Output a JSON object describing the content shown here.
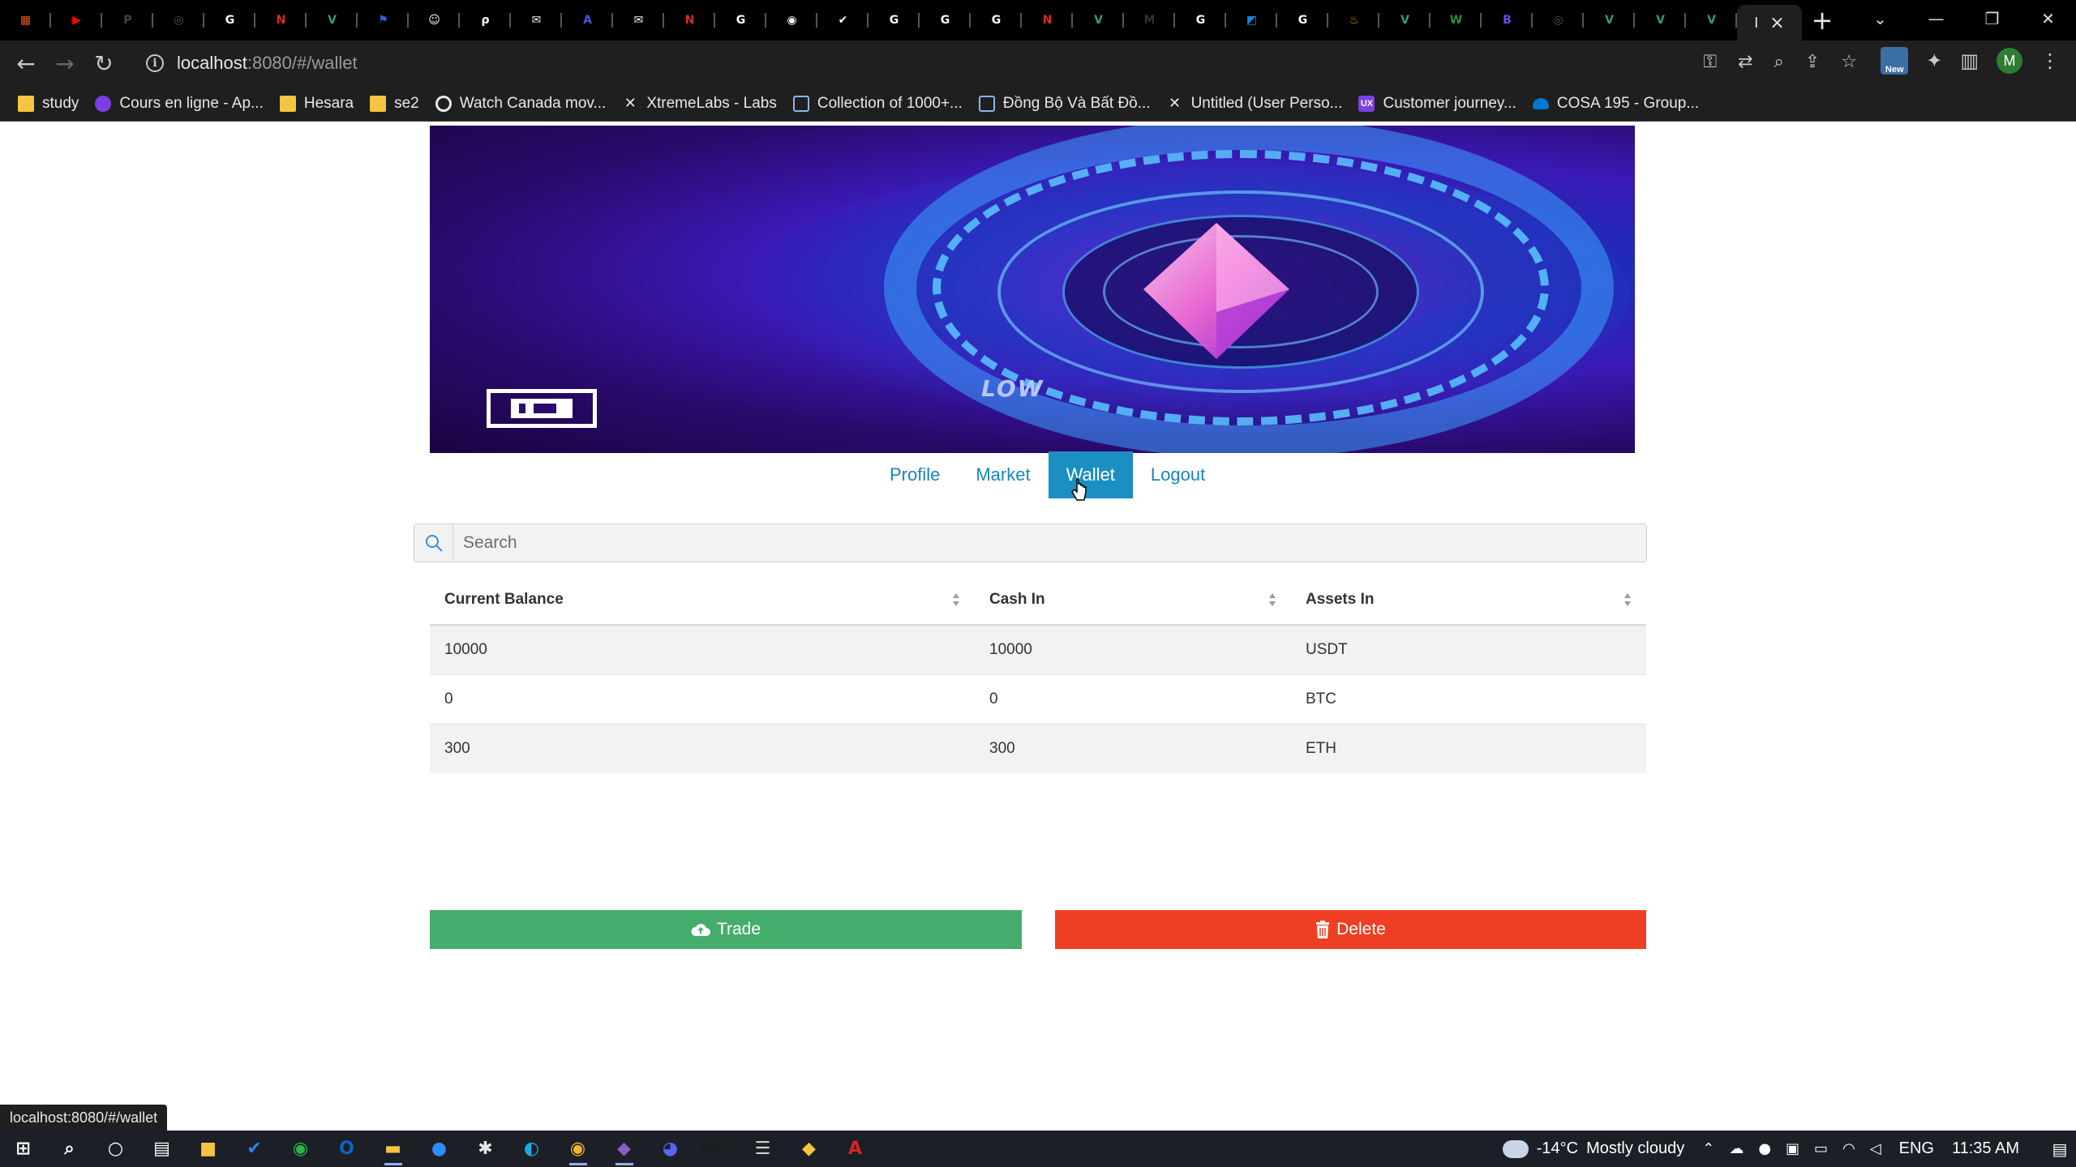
{
  "browser": {
    "tabs": [
      {
        "icon": "grid-app-icon",
        "color": "#e8590c",
        "glyph": "▦"
      },
      {
        "icon": "youtube-icon",
        "color": "#ff0000",
        "glyph": "▶"
      },
      {
        "icon": "pdf-tab-icon",
        "color": "#444444",
        "glyph": "P"
      },
      {
        "icon": "globe-icon",
        "color": "#555555",
        "glyph": "◎"
      },
      {
        "icon": "google-icon",
        "color": "#ffffff",
        "glyph": "G"
      },
      {
        "icon": "notion-red-icon",
        "color": "#d92b2b",
        "glyph": "N"
      },
      {
        "icon": "vue-icon",
        "color": "#2f9e6f",
        "glyph": "V"
      },
      {
        "icon": "flag-icon",
        "color": "#3b5bdb",
        "glyph": "⚑"
      },
      {
        "icon": "smile-icon",
        "color": "#ffffff",
        "glyph": "☺"
      },
      {
        "icon": "leaf-icon",
        "color": "#ffffff",
        "glyph": "ρ"
      },
      {
        "icon": "chat-icon",
        "color": "#ffffff",
        "glyph": "✉"
      },
      {
        "icon": "api-icon",
        "color": "#3b5bdb",
        "glyph": "A"
      },
      {
        "icon": "chat-icon",
        "color": "#ffffff",
        "glyph": "✉"
      },
      {
        "icon": "notion-red-icon",
        "color": "#d92b2b",
        "glyph": "N"
      },
      {
        "icon": "google-icon",
        "color": "#ffffff",
        "glyph": "G"
      },
      {
        "icon": "github-icon",
        "color": "#ffffff",
        "glyph": "◉"
      },
      {
        "icon": "check-circle-icon",
        "color": "#ffffff",
        "glyph": "✔"
      },
      {
        "icon": "google-icon",
        "color": "#ffffff",
        "glyph": "G"
      },
      {
        "icon": "google-icon",
        "color": "#ffffff",
        "glyph": "G"
      },
      {
        "icon": "google-icon",
        "color": "#ffffff",
        "glyph": "G"
      },
      {
        "icon": "notion-red-icon",
        "color": "#d92b2b",
        "glyph": "N"
      },
      {
        "icon": "vue-icon",
        "color": "#2f9e6f",
        "glyph": "V"
      },
      {
        "icon": "medium-icon",
        "color": "#333333",
        "glyph": "M"
      },
      {
        "icon": "google-icon",
        "color": "#ffffff",
        "glyph": "G"
      },
      {
        "icon": "box-icon",
        "color": "#1c7ed6",
        "glyph": "◩"
      },
      {
        "icon": "google-icon",
        "color": "#ffffff",
        "glyph": "G"
      },
      {
        "icon": "flame-icon",
        "color": "#f08c00",
        "glyph": "♨"
      },
      {
        "icon": "vue-icon",
        "color": "#2f9e6f",
        "glyph": "V"
      },
      {
        "icon": "webflow-icon",
        "color": "#2b8a3e",
        "glyph": "W"
      },
      {
        "icon": "bootstrap-icon",
        "color": "#7048e8",
        "glyph": "B"
      },
      {
        "icon": "globe-icon",
        "color": "#555555",
        "glyph": "◎"
      },
      {
        "icon": "vue-icon",
        "color": "#2f9e6f",
        "glyph": "V"
      },
      {
        "icon": "vue-icon",
        "color": "#2f9e6f",
        "glyph": "V"
      },
      {
        "icon": "vue-icon",
        "color": "#2f9e6f",
        "glyph": "V"
      }
    ],
    "active_tab_label": "I",
    "url_host": "localhost",
    "url_path": ":8080/#/wallet",
    "status_url": "localhost:8080/#/wallet",
    "bookmarks": [
      {
        "label": "study",
        "icon": "folder-icon",
        "kind": "folder"
      },
      {
        "label": "Cours en ligne - Ap...",
        "icon": "course-icon",
        "kind": "purple"
      },
      {
        "label": "Hesara",
        "icon": "folder-icon",
        "kind": "folder"
      },
      {
        "label": "se2",
        "icon": "folder-icon",
        "kind": "folder"
      },
      {
        "label": "Watch Canada mov...",
        "icon": "film-reel-icon",
        "kind": "wheel"
      },
      {
        "label": "XtremeLabs - Labs",
        "icon": "x-logo-icon",
        "kind": "x"
      },
      {
        "label": "Collection of 1000+...",
        "icon": "grid-icon",
        "kind": "grid"
      },
      {
        "label": "Đồng Bộ Và Bất Đồ...",
        "icon": "document-icon",
        "kind": "grid"
      },
      {
        "label": "Untitled (User Perso...",
        "icon": "x-logo-icon",
        "kind": "x"
      },
      {
        "label": "Customer journey...",
        "icon": "ux-icon",
        "kind": "ux"
      },
      {
        "label": "COSA 195 - Group...",
        "icon": "onedrive-icon",
        "kind": "cloud"
      }
    ],
    "profile_initial": "M",
    "new_badge": "New"
  },
  "page": {
    "nav": [
      {
        "label": "Profile",
        "active": false
      },
      {
        "label": "Market",
        "active": false
      },
      {
        "label": "Wallet",
        "active": true
      },
      {
        "label": "Logout",
        "active": false
      }
    ],
    "banner": {
      "caption": "LOW"
    },
    "search": {
      "placeholder": "Search",
      "value": ""
    },
    "table": {
      "columns": [
        "Current Balance",
        "Cash In",
        "Assets In"
      ],
      "rows": [
        [
          "10000",
          "10000",
          "USDT"
        ],
        [
          "0",
          "0",
          "BTC"
        ],
        [
          "300",
          "300",
          "ETH"
        ]
      ]
    },
    "buttons": {
      "trade": "Trade",
      "delete": "Delete"
    }
  },
  "taskbar": {
    "apps": [
      {
        "icon": "windows-start-icon",
        "color": "#ffffff",
        "glyph": "⊞",
        "running": false
      },
      {
        "icon": "search-icon",
        "color": "#ffffff",
        "glyph": "⌕",
        "running": false
      },
      {
        "icon": "cortana-icon",
        "color": "#ffffff",
        "glyph": "○",
        "running": false
      },
      {
        "icon": "task-view-icon",
        "color": "#ffffff",
        "glyph": "▤",
        "running": false
      },
      {
        "icon": "sticky-notes-icon",
        "color": "#f5c542",
        "glyph": "■",
        "running": false
      },
      {
        "icon": "todo-icon",
        "color": "#2f80ed",
        "glyph": "✔",
        "running": false
      },
      {
        "icon": "xbox-icon",
        "color": "#2fb344",
        "glyph": "◉",
        "running": false
      },
      {
        "icon": "outlook-icon",
        "color": "#0a64c8",
        "glyph": "O",
        "running": false
      },
      {
        "icon": "file-explorer-icon",
        "color": "#f5c542",
        "glyph": "▬",
        "running": true
      },
      {
        "icon": "zoom-icon",
        "color": "#2d8cff",
        "glyph": "●",
        "running": false
      },
      {
        "icon": "slack-icon",
        "color": "#e8e8e8",
        "glyph": "✱",
        "running": false
      },
      {
        "icon": "edge-icon",
        "color": "#1ea7e1",
        "glyph": "◐",
        "running": false
      },
      {
        "icon": "chrome-icon",
        "color": "#f2b630",
        "glyph": "◉",
        "running": true
      },
      {
        "icon": "visual-studio-icon",
        "color": "#865fc5",
        "glyph": "◆",
        "running": true
      },
      {
        "icon": "discord-icon",
        "color": "#5865f2",
        "glyph": "◕",
        "running": false
      },
      {
        "icon": "webstorm-icon",
        "color": "#1e1e1e",
        "glyph": "WS",
        "running": false
      },
      {
        "icon": "database-icon",
        "color": "#cfcfcf",
        "glyph": "☰",
        "running": false
      },
      {
        "icon": "git-icon",
        "color": "#f5c542",
        "glyph": "◆",
        "running": false
      },
      {
        "icon": "acrobat-icon",
        "color": "#d7261e",
        "glyph": "A",
        "running": false
      }
    ],
    "weather": {
      "temp": "-14°C",
      "condition": "Mostly cloudy"
    },
    "language": "ENG",
    "time": "11:35 AM"
  }
}
